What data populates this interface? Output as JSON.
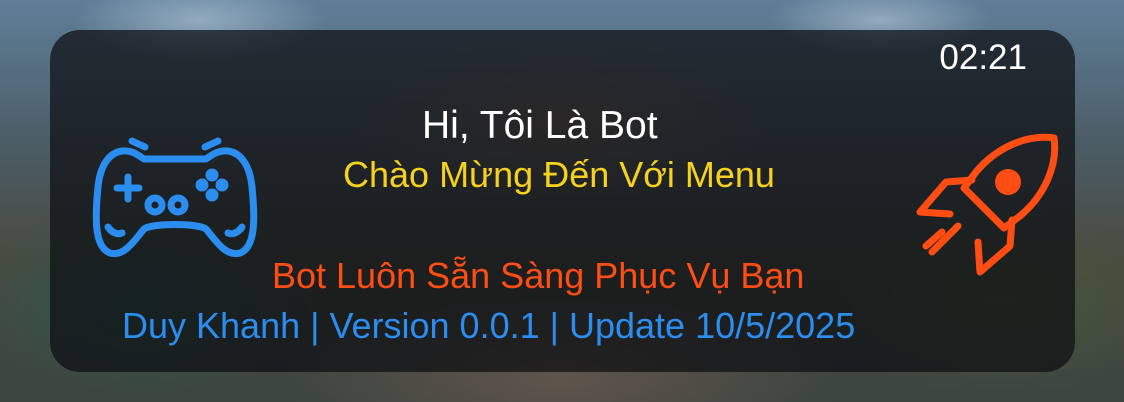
{
  "clock": "02:21",
  "greeting": "Hi, Tôi Là Bot",
  "welcome": "Chào Mừng Đến Với Menu",
  "tagline": "Bot Luôn Sẵn Sàng Phục Vụ Bạn",
  "credits": "Duy Khanh | Version 0.0.1 | Update 10/5/2025",
  "icons": {
    "left": "gamepad-icon",
    "right": "rocket-icon"
  },
  "colors": {
    "panel": "#0c0e12",
    "greeting": "#ffffff",
    "welcome": "#f6d21c",
    "tagline": "#ff4d14",
    "credits": "#2b8df0",
    "gamepad": "#2b8df0",
    "rocket": "#ff4d14"
  }
}
